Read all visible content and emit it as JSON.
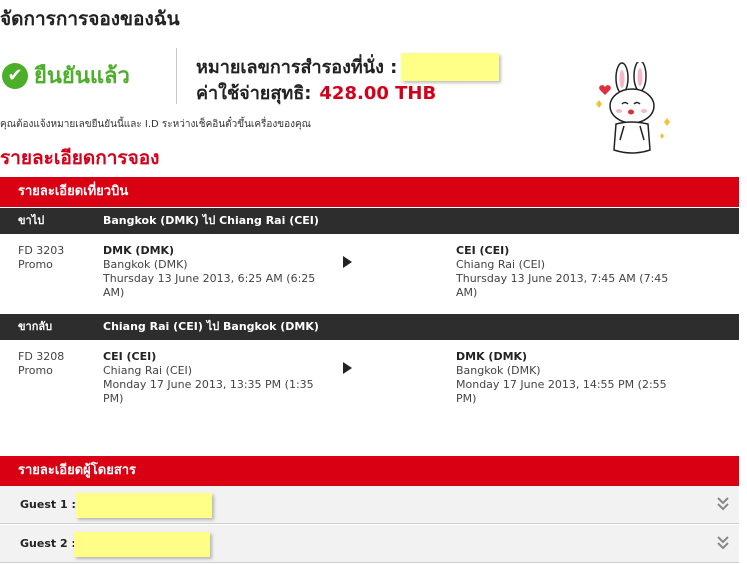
{
  "page": {
    "title": "จัดการการจองของฉัน"
  },
  "confirmation": {
    "status_label": "ยืนยันแล้ว",
    "reference_label": "หมายเลขการสำรองที่นั่ง :",
    "reference_value": "",
    "total_label": "ค่าใช้จ่ายสุทธิ:",
    "total_amount": "428.00 THB",
    "notice": "คุณต้องแจ้งหมายเลขยืนยันนี้และ I.D ระหว่างเช็คอินตั๋วขึ้นเครื่องของคุณ"
  },
  "booking_details": {
    "title": "รายละเอียดการจอง"
  },
  "flight_details": {
    "header": "รายละเอียดเที่ยวบิน",
    "legs": [
      {
        "direction": "ขาไป",
        "route": "Bangkok (DMK) ไป Chiang Rai (CEI)",
        "flight_number": "FD 3203",
        "fare_class": "Promo",
        "departure": {
          "code": "DMK (DMK)",
          "city": "Bangkok (DMK)",
          "datetime_line1": "Thursday 13 June 2013, 6:25 AM (6:25",
          "datetime_line2": "AM)"
        },
        "arrival": {
          "code": "CEI (CEI)",
          "city": "Chiang Rai (CEI)",
          "datetime_line1": "Thursday 13 June 2013, 7:45 AM (7:45",
          "datetime_line2": "AM)"
        }
      },
      {
        "direction": "ขากลับ",
        "route": "Chiang Rai (CEI) ไป Bangkok (DMK)",
        "flight_number": "FD 3208",
        "fare_class": "Promo",
        "departure": {
          "code": "CEI (CEI)",
          "city": "Chiang Rai (CEI)",
          "datetime_line1": "Monday 17 June 2013, 13:35 PM (1:35",
          "datetime_line2": "PM)"
        },
        "arrival": {
          "code": "DMK (DMK)",
          "city": "Bangkok (DMK)",
          "datetime_line1": "Monday 17 June 2013, 14:55 PM (2:55",
          "datetime_line2": "PM)"
        }
      }
    ]
  },
  "passenger_details": {
    "header": "รายละเอียดผู้โดยสาร",
    "guests": [
      {
        "label": "Guest 1 : S",
        "expand_icon": "double-chevron-down-icon"
      },
      {
        "label": "Guest 2 : S",
        "expand_icon": "double-chevron-down-icon"
      }
    ]
  },
  "colors": {
    "brand_red": "#d90014",
    "confirm_green": "#4caf2a",
    "leg_bar": "#2d2d2d",
    "redaction_yellow": "#ffff88"
  }
}
